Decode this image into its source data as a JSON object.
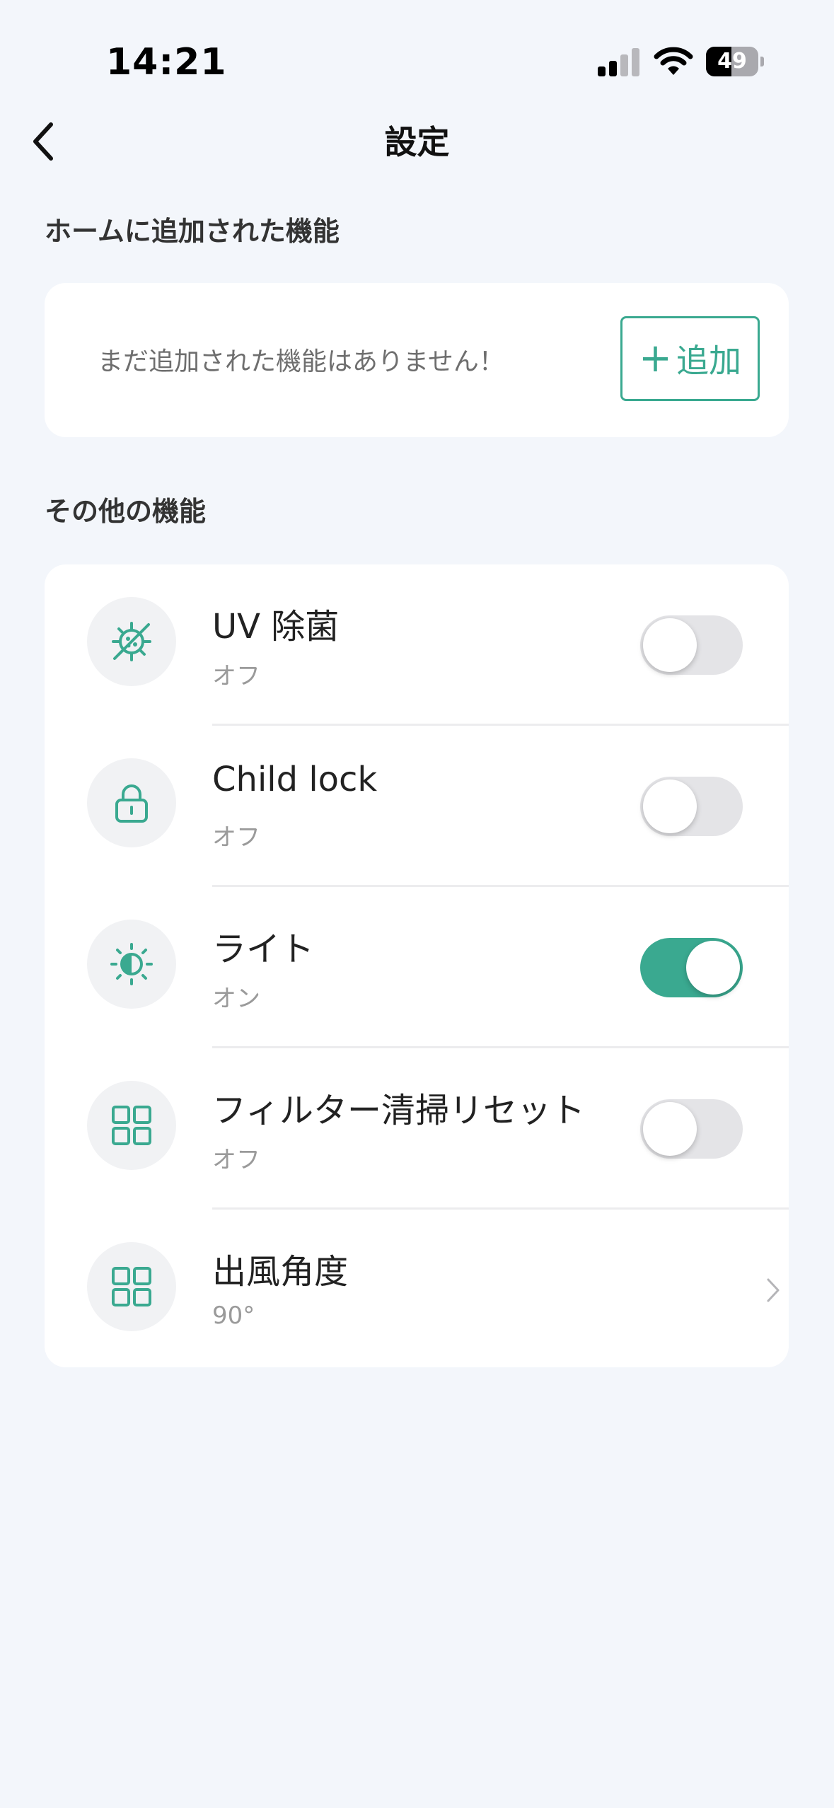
{
  "status_bar": {
    "time": "14:21",
    "battery": "49",
    "battery_level": 0.49
  },
  "header": {
    "title": "設定",
    "back_icon": "chevron-left-icon"
  },
  "home_section": {
    "title": "ホームに追加された機能",
    "empty_text": "まだ追加された機能はありません！",
    "add_button_label": "追加"
  },
  "other_section": {
    "title": "その他の機能",
    "items": [
      {
        "icon": "uv-sterilize-icon",
        "title": "UV 除菌",
        "status": "オフ",
        "control": "toggle",
        "on": false
      },
      {
        "icon": "lock-icon",
        "title": "Child lock",
        "status": "オフ",
        "control": "toggle",
        "on": false
      },
      {
        "icon": "light-icon",
        "title": "ライト",
        "status": "オン",
        "control": "toggle",
        "on": true
      },
      {
        "icon": "grid-icon",
        "title": "フィルター清掃リセット",
        "status": "オフ",
        "control": "toggle",
        "on": false
      },
      {
        "icon": "grid-icon",
        "title": "出風角度",
        "status": "90°",
        "control": "chevron"
      }
    ]
  },
  "colors": {
    "accent": "#3aa990",
    "background": "#f3f6fb",
    "card": "#ffffff",
    "toggle_off": "#e4e4e7"
  }
}
